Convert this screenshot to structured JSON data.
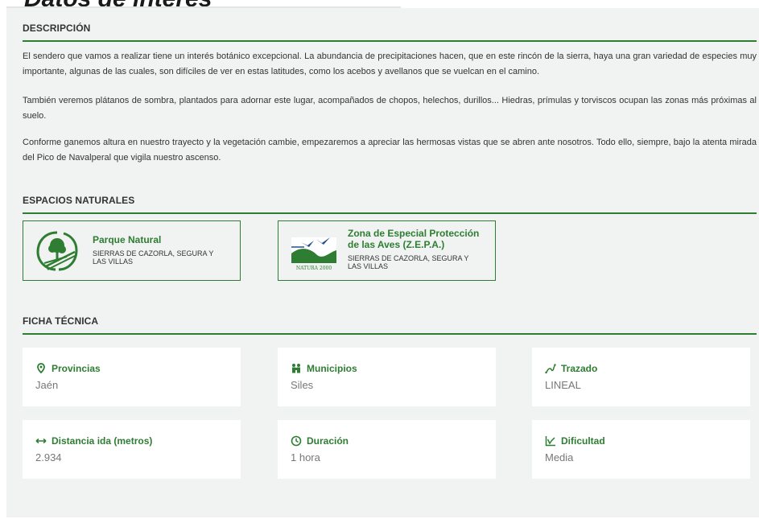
{
  "page": {
    "title": "Datos de interés"
  },
  "descripcion": {
    "heading": "DESCRIPCIÓN",
    "paragraphs": [
      "El sendero que vamos a realizar tiene un interés botánico excepcional. La abundancia de precipitaciones hacen, que en este rincón de la sierra, haya una gran variedad de especies muy importante, algunas de las cuales, son difíciles de ver en estas latitudes, como los acebos y avellanos que se vuelcan en el camino.",
      "También veremos plátanos de sombra, plantados para adornar este lugar, acompañados de chopos, helechos, durillos... Hiedras, prímulas y torviscos ocupan las zonas más próximas al suelo.",
      "Conforme ganemos altura en nuestro trayecto y la vegetación cambie, empezaremos a apreciar las hermosas vistas que se abren ante nosotros. Todo ello, siempre, bajo la atenta mirada del Pico de Navalperal que vigila nuestro ascenso."
    ]
  },
  "espacios": {
    "heading": "ESPACIOS NATURALES",
    "items": [
      {
        "name": "Parque Natural",
        "place": "SIERRAS DE CAZORLA, SEGURA Y LAS VILLAS",
        "icon": "parque-natural-logo"
      },
      {
        "name": "Zona de Especial Protección de las Aves (Z.E.P.A.)",
        "place": "SIERRAS DE CAZORLA, SEGURA Y LAS VILLAS",
        "icon": "natura-2000-logo",
        "logo_text": "NATURA 2000"
      }
    ]
  },
  "ficha": {
    "heading": "FICHA TÉCNICA",
    "items": [
      {
        "label": "Provincias",
        "value": "Jaén",
        "icon": "map-pin-icon"
      },
      {
        "label": "Municipios",
        "value": "Siles",
        "icon": "people-icon"
      },
      {
        "label": "Trazado",
        "value": "LINEAL",
        "icon": "route-icon"
      },
      {
        "label": "Distancia ida (metros)",
        "value": "2.934",
        "icon": "distance-arrows-icon"
      },
      {
        "label": "Duración",
        "value": "1 hora",
        "icon": "clock-icon"
      },
      {
        "label": "Dificultad",
        "value": "Media",
        "icon": "difficulty-chart-icon"
      }
    ]
  },
  "colors": {
    "accent": "#2e7d32",
    "panel": "#f0f3f1",
    "card": "#ffffff",
    "value_text": "#777777"
  }
}
